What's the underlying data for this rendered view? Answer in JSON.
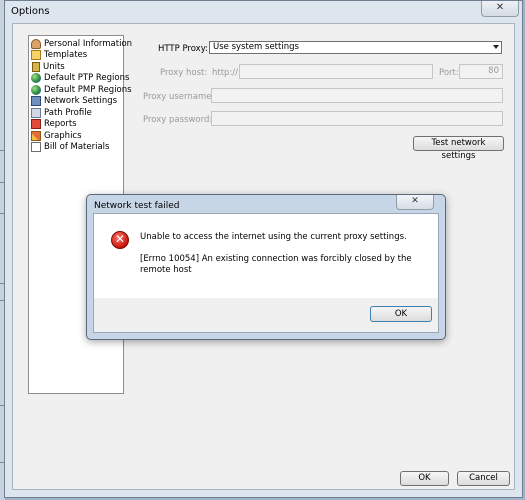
{
  "window": {
    "title": "Options",
    "close_glyph": "✕"
  },
  "sidebar": {
    "items": [
      {
        "label": "Personal Information",
        "icon": "person-icon"
      },
      {
        "label": "Templates",
        "icon": "templates-icon"
      },
      {
        "label": "Units",
        "icon": "units-icon"
      },
      {
        "label": "Default PTP Regions",
        "icon": "globe-icon"
      },
      {
        "label": "Default PMP Regions",
        "icon": "globe-icon"
      },
      {
        "label": "Network Settings",
        "icon": "network-icon"
      },
      {
        "label": "Path Profile",
        "icon": "path-profile-icon"
      },
      {
        "label": "Reports",
        "icon": "reports-icon"
      },
      {
        "label": "Graphics",
        "icon": "graphics-icon"
      },
      {
        "label": "Bill of Materials",
        "icon": "bill-of-materials-icon"
      }
    ]
  },
  "network": {
    "http_proxy_label": "HTTP Proxy:",
    "http_proxy_value": "Use system settings",
    "proxy_host_label": "Proxy host:",
    "proxy_host_prefix": "http://",
    "port_label": "Port:",
    "port_value": "80",
    "username_label": "Proxy username:",
    "password_label": "Proxy password:",
    "test_button": "Test network settings"
  },
  "footer": {
    "ok": "OK",
    "cancel": "Cancel"
  },
  "dialog": {
    "title": "Network test failed",
    "close_glyph": "✕",
    "icon": "error-icon",
    "message": "Unable to access the internet using the current proxy settings.",
    "detail": "[Errno 10054] An existing connection was forcibly closed by the remote host",
    "ok": "OK"
  }
}
